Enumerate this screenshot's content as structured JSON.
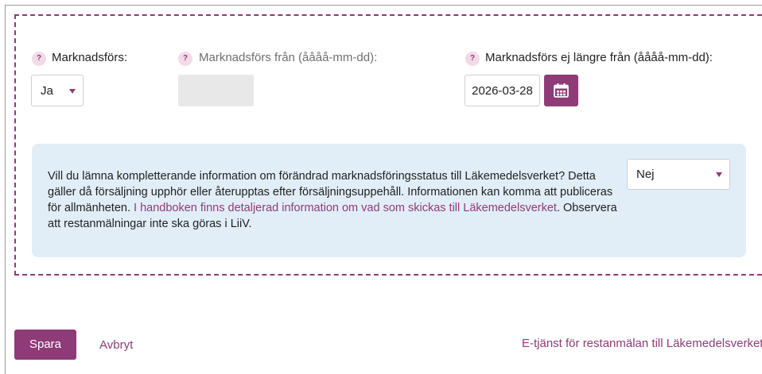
{
  "form": {
    "marketed": {
      "help_icon": "?",
      "label": "Marknadsförs:",
      "value": "Ja"
    },
    "marketed_from": {
      "help_icon": "?",
      "label": "Marknadsförs från (åååå-mm-dd):",
      "value": ""
    },
    "marketed_until": {
      "help_icon": "?",
      "label": "Marknadsförs ej längre från (åååå-mm-dd):",
      "value": "2026-03-28",
      "calendar_icon": "calendar-icon"
    }
  },
  "info": {
    "text_before_link": "Vill du lämna kompletterande information om förändrad marknadsföringsstatus till Läkemedelsverket? Detta gäller då försäljning upphör eller återupptas efter försäljningsuppehåll. Informationen kan komma att publiceras för allmänheten. ",
    "link_text": "I handboken finns detaljerad information om vad som skickas till Läkemedelsverket",
    "text_after_link": ". Observera att restanmälningar inte ska göras i LiiV.",
    "select_value": "Nej"
  },
  "actions": {
    "save_label": "Spara",
    "cancel_label": "Avbryt",
    "etjanst_link": "E-tjänst för restanmälan till Läkemedelsverket"
  },
  "colors": {
    "accent": "#8e3b78",
    "info_background": "#e1eef8",
    "disabled_field": "#e8e8e8",
    "help_badge": "#f2dbe8"
  }
}
